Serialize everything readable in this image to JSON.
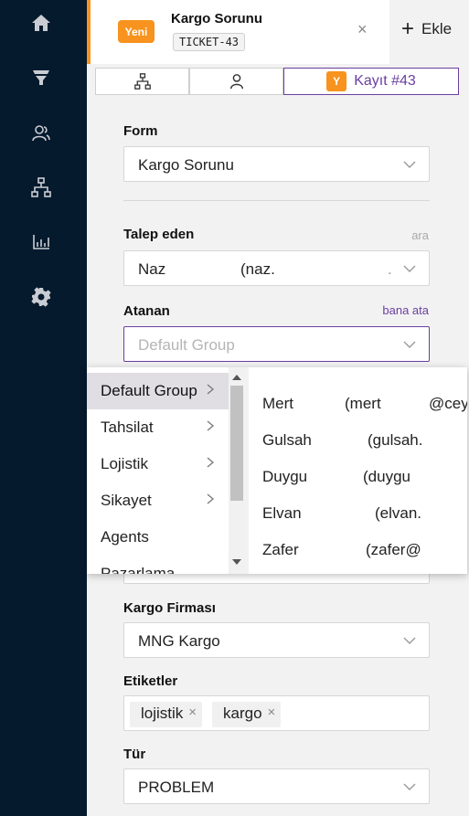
{
  "nav": {
    "icons": [
      "home-icon",
      "funnel-icon",
      "users-icon",
      "hierarchy-icon",
      "chart-icon",
      "gear-icon"
    ]
  },
  "tab": {
    "badge": "Yeni",
    "title": "Kargo Sorunu",
    "code": "TICKET-43",
    "close": "×",
    "add_label": "Ekle",
    "add_plus": "+"
  },
  "subtabs": {
    "record_badge": "Y",
    "record_label": "Kayıt #43"
  },
  "form": {
    "form_label": "Form",
    "form_value": "Kargo Sorunu",
    "requester_label": "Talep eden",
    "requester_hint": "ara",
    "requester_name": "Naz",
    "requester_handle": "(naz.",
    "requester_tail": ".",
    "assignee_label": "Atanan",
    "assignee_hint": "bana ata",
    "assignee_placeholder": "Default Group",
    "hidden_label_partial": "Pazarlama",
    "cargo_label": "Kargo Firması",
    "cargo_value": "MNG Kargo",
    "tags_label": "Etiketler",
    "tags": [
      "lojistik",
      "kargo"
    ],
    "tag_remove": "×",
    "type_label": "Tür",
    "type_value": "PROBLEM"
  },
  "dropdown": {
    "groups": [
      {
        "label": "Default Group",
        "has_children": true,
        "selected": true
      },
      {
        "label": "Tahsilat",
        "has_children": true,
        "selected": false
      },
      {
        "label": "Lojistik",
        "has_children": true,
        "selected": false
      },
      {
        "label": "Sikayet",
        "has_children": true,
        "selected": false
      },
      {
        "label": "Agents",
        "has_children": false,
        "selected": false
      },
      {
        "label": "Pazarlama",
        "has_children": false,
        "selected": false
      }
    ],
    "agents": [
      {
        "name": "Mert",
        "handle": "(mert",
        "extra": "@cey"
      },
      {
        "name": "Gulsah",
        "handle": "(gulsah.",
        "extra": ""
      },
      {
        "name": "Duygu",
        "handle": "(duygu",
        "extra": ""
      },
      {
        "name": "Elvan",
        "handle": "(elvan.",
        "extra": ""
      },
      {
        "name": "Zafer",
        "handle": "(zafer@",
        "extra": ""
      }
    ]
  },
  "colors": {
    "nav_bg": "#061a2e",
    "accent_orange": "#f7931e",
    "accent_purple": "#6a3fa0",
    "hint_gray": "#aaaaaa"
  }
}
